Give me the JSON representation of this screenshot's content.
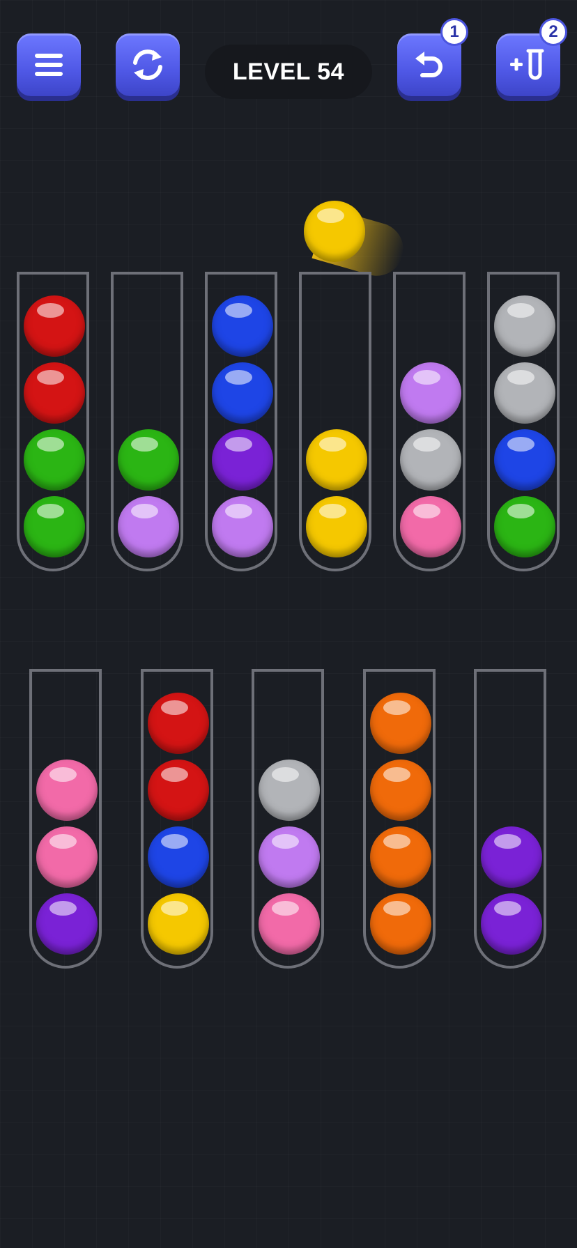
{
  "header": {
    "level_label": "LEVEL 54",
    "menu_icon": "hamburger-menu-icon",
    "restart_icon": "restart-arrows-icon",
    "undo_icon": "undo-arrow-icon",
    "undo_badge": "1",
    "add_tube_icon": "add-tube-icon",
    "add_tube_badge": "2"
  },
  "colors": {
    "red": "#d41414",
    "green": "#2bb514",
    "lilac": "#c07af0",
    "blue": "#1e45e6",
    "purple": "#7a22d6",
    "yellow": "#f5c800",
    "grey": "#b2b4b8",
    "pink": "#f26aa8",
    "orange": "#f06a0a",
    "accent": "#5560ef"
  },
  "lifted_ball": "yellow",
  "rows": [
    [
      [
        "red",
        "red",
        "green",
        "green"
      ],
      [
        "green",
        "lilac"
      ],
      [
        "blue",
        "blue",
        "purple",
        "lilac"
      ],
      [
        "yellow",
        "yellow"
      ],
      [
        "lilac",
        "grey",
        "pink"
      ],
      [
        "grey",
        "grey",
        "blue",
        "green"
      ]
    ],
    [
      [
        "pink",
        "pink",
        "purple"
      ],
      [
        "red",
        "red",
        "blue",
        "yellow"
      ],
      [
        "grey",
        "lilac",
        "pink"
      ],
      [
        "orange",
        "orange",
        "orange",
        "orange"
      ],
      [
        "purple",
        "purple"
      ]
    ]
  ]
}
